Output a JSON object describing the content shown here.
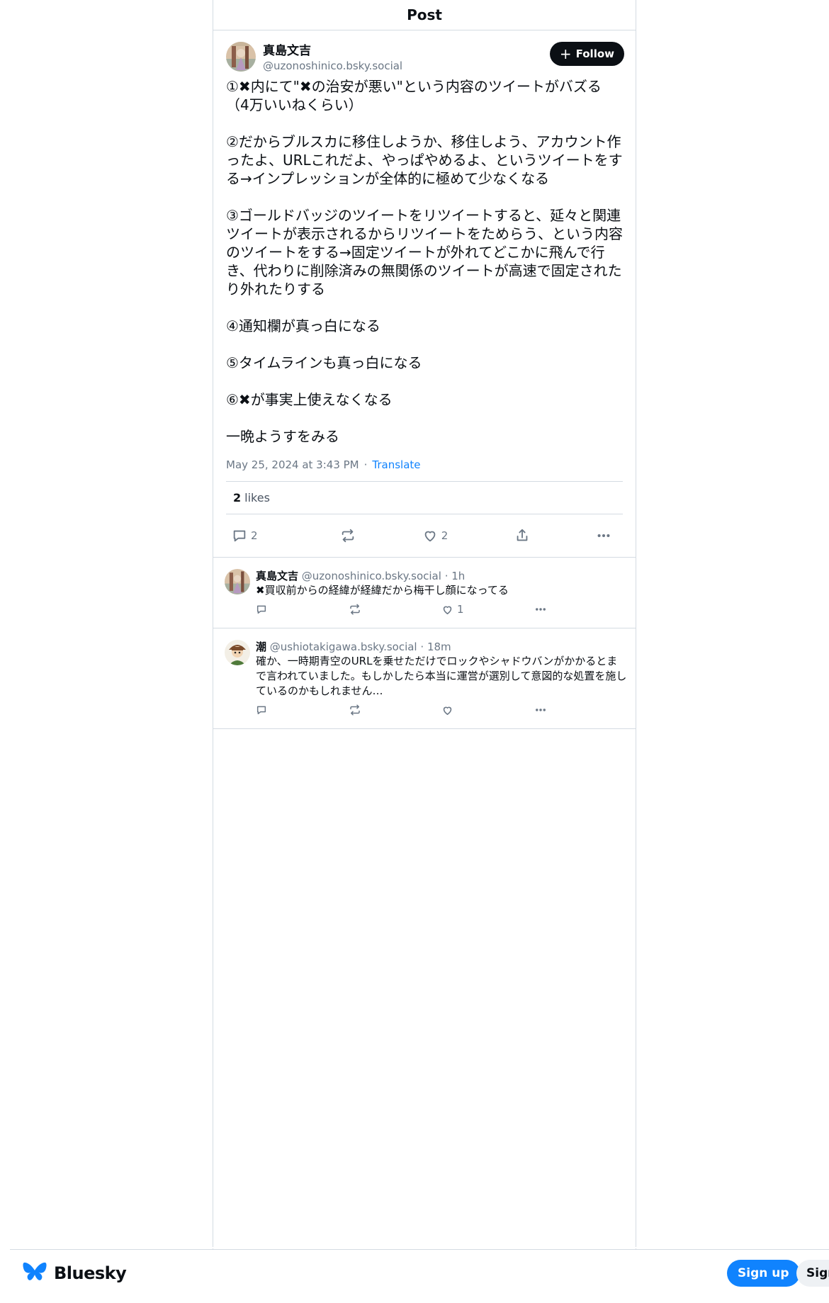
{
  "header": {
    "title": "Post"
  },
  "main_post": {
    "author": {
      "display_name": "真島文吉",
      "handle": "@uzonoshinico.bsky.social"
    },
    "follow_label": "Follow",
    "text": "①✖内にて\"✖の治安が悪い\"という内容のツイートがバズる（4万いいねくらい）\n\n②だからブルスカに移住しようか、移住しよう、アカウント作ったよ、URLこれだよ、やっぱやめるよ、というツイートをする→インプレッションが全体的に極めて少なくなる\n\n③ゴールドバッジのツイートをリツイートすると、延々と関連ツイートが表示されるからリツイートをためらう、という内容のツイートをする→固定ツイートが外れてどこかに飛んで行き、代わりに削除済みの無関係のツイートが高速で固定されたり外れたりする\n\n④通知欄が真っ白になる\n\n⑤タイムラインも真っ白になる\n\n⑥✖が事実上使えなくなる\n\n一晩ようすをみる",
    "timestamp": "May 25, 2024 at 3:43 PM",
    "separator": "·",
    "translate_label": "Translate",
    "likes_count": "2",
    "likes_label": "likes",
    "reply_count": "2",
    "like_count": "2"
  },
  "replies": [
    {
      "display_name": "真島文吉",
      "handle": "@uzonoshinico.bsky.social",
      "separator": "·",
      "time": "1h",
      "text": "✖買収前からの経緯が経緯だから梅干し顔になってる",
      "like_count": "1",
      "avatar": "avatar-illustration"
    },
    {
      "display_name": "潮󠄀",
      "handle": "@ushiotakigawa.bsky.social",
      "separator": "·",
      "time": "18m",
      "text": "確か、一時期青空のURLを乗せただけでロックやシャドウバンがかかるとまで言われていました。もしかしたら本当に運営が選別して意図的な処置を施しているのかもしれません…",
      "like_count": "",
      "avatar": "avatar-character"
    }
  ],
  "footer": {
    "brand": "Bluesky",
    "signup_label": "Sign up",
    "signin_label": "Sign in"
  },
  "colors": {
    "accent": "#1083fe",
    "border": "#d4dbe2",
    "muted_text": "#6b7785",
    "follow_bg": "#0b0f14"
  },
  "icons": [
    "reply-icon",
    "repost-icon",
    "like-icon",
    "share-icon",
    "more-icon",
    "butterfly-icon"
  ]
}
